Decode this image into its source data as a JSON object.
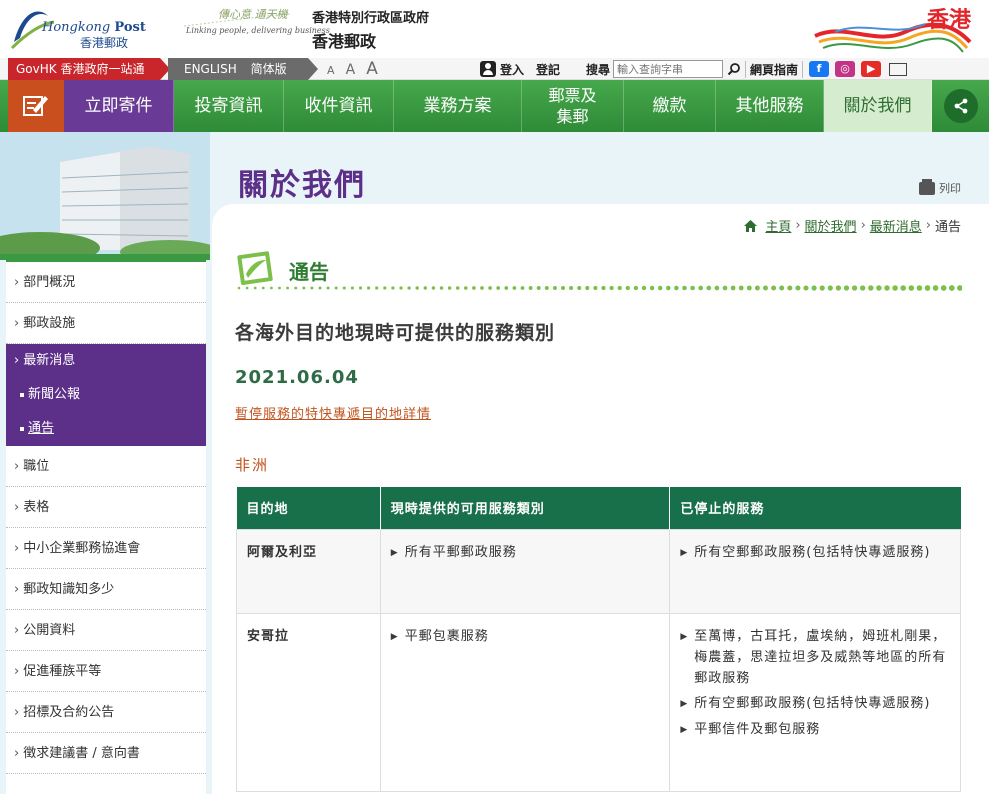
{
  "header": {
    "logo_en_a": "Hongkong",
    "logo_en_b": "Post",
    "logo_zh": "香港郵政",
    "slogan_zh": "傳心意 通天機",
    "slogan_en": "Linking people, delivering business",
    "gov_line1": "香港特別行政區政府",
    "gov_line2": "香港郵政",
    "brand_hk": "香港"
  },
  "utility": {
    "govhk": "GovHK 香港政府一站通",
    "english": "ENGLISH",
    "simplified": "简体版",
    "font_small": "A",
    "font_medium": "A",
    "font_large": "A",
    "login": "登入",
    "register": "登記",
    "search_label": "搜尋",
    "search_placeholder": "輸入查詢字串",
    "sitemap": "網頁指南"
  },
  "nav": {
    "items": [
      {
        "label": "立即寄件"
      },
      {
        "label": "投寄資訊"
      },
      {
        "label": "收件資訊"
      },
      {
        "label": "業務方案"
      },
      {
        "label": "郵票及集郵"
      },
      {
        "label": "繳款"
      },
      {
        "label": "其他服務"
      },
      {
        "label": "關於我們"
      }
    ]
  },
  "sidebar": {
    "items": [
      {
        "label": "部門概況"
      },
      {
        "label": "郵政設施"
      },
      {
        "label": "最新消息"
      },
      {
        "label": "新聞公報"
      },
      {
        "label": "通告"
      },
      {
        "label": "職位"
      },
      {
        "label": "表格"
      },
      {
        "label": "中小企業郵務協進會"
      },
      {
        "label": "郵政知識知多少"
      },
      {
        "label": "公開資料"
      },
      {
        "label": "促進種族平等"
      },
      {
        "label": "招標及合約公告"
      },
      {
        "label": "徵求建議書 / 意向書"
      }
    ]
  },
  "page": {
    "title": "關於我們",
    "print": "列印",
    "breadcrumb": [
      "主頁",
      "關於我們",
      "最新消息",
      "通告"
    ],
    "section": "通告",
    "article_title": "各海外目的地現時可提供的服務類別",
    "date": "2021.06.04",
    "suspended_link": "暫停服務的特快專遞目的地詳情",
    "region": "非洲"
  },
  "table": {
    "headers": [
      "目的地",
      "現時提供的可用服務類別",
      "已停止的服務"
    ],
    "rows": [
      {
        "destination": "阿爾及利亞",
        "available": [
          "所有平郵郵政服務"
        ],
        "stopped": [
          "所有空郵郵政服務(包括特快專遞服務)"
        ]
      },
      {
        "destination": "安哥拉",
        "available": [
          "平郵包裹服務"
        ],
        "stopped": [
          "至萬博，古耳托，盧埃納，姆班札剛果，梅農蓋，思達拉坦多及威熱等地區的所有郵政服務",
          "所有空郵郵政服務(包括特快專遞服務)",
          "平郵信件及郵包服務"
        ]
      }
    ]
  },
  "colors": {
    "nav_green": "#3a9a44",
    "purple": "#5c3089",
    "table_header": "#18704a",
    "link_orange": "#c0541e",
    "govhk_red": "#c9262c"
  }
}
